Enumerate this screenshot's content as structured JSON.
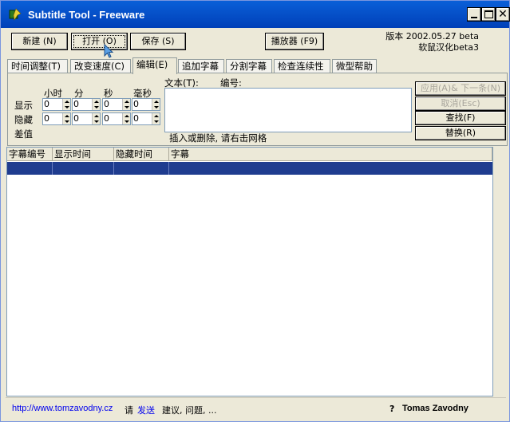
{
  "window": {
    "title": "Subtitle Tool - Freeware"
  },
  "toolbar": {
    "new_label": "新建 (N)",
    "open_label": "打开 (O)",
    "save_label": "保存 (S)",
    "player_label": "播放器  (F9)"
  },
  "version": {
    "line1": "版本 2002.05.27 beta",
    "line2": "软鼠汉化beta3"
  },
  "tabs": [
    "时间调整(T)",
    "改变速度(C)",
    "编辑(E)",
    "追加字幕",
    "分割字幕",
    "检查连续性",
    "微型帮助"
  ],
  "active_tab": 2,
  "edit": {
    "headers": {
      "hour": "小时",
      "minute": "分",
      "second": "秒",
      "ms": "毫秒"
    },
    "rows": {
      "show": "显示",
      "hide": "隐藏",
      "diff": "差值"
    },
    "show_values": [
      "0",
      "0",
      "0",
      "0"
    ],
    "hide_values": [
      "0",
      "0",
      "0",
      "0"
    ],
    "text_label": "文本(T):",
    "number_label": "编号:",
    "hint": "插入或删除, 请右击网格",
    "buttons": {
      "apply_next": "应用(A)& 下一条(N)",
      "cancel": "取消(Esc)",
      "find": "查找(F)",
      "replace": "替换(R)"
    }
  },
  "grid": {
    "columns": [
      "字幕编号",
      "显示时间",
      "隐藏时间",
      "字幕"
    ]
  },
  "status": {
    "url": "http://www.tomzavodny.cz",
    "please": "请",
    "send": "发送",
    "suggest": "建议, 问题, ...",
    "help_mark": "?",
    "author": "Tomas Zavodny"
  },
  "colors": {
    "titlebar": "#0a5fd8",
    "selection": "#1f3c8f",
    "face": "#ece9d8"
  }
}
